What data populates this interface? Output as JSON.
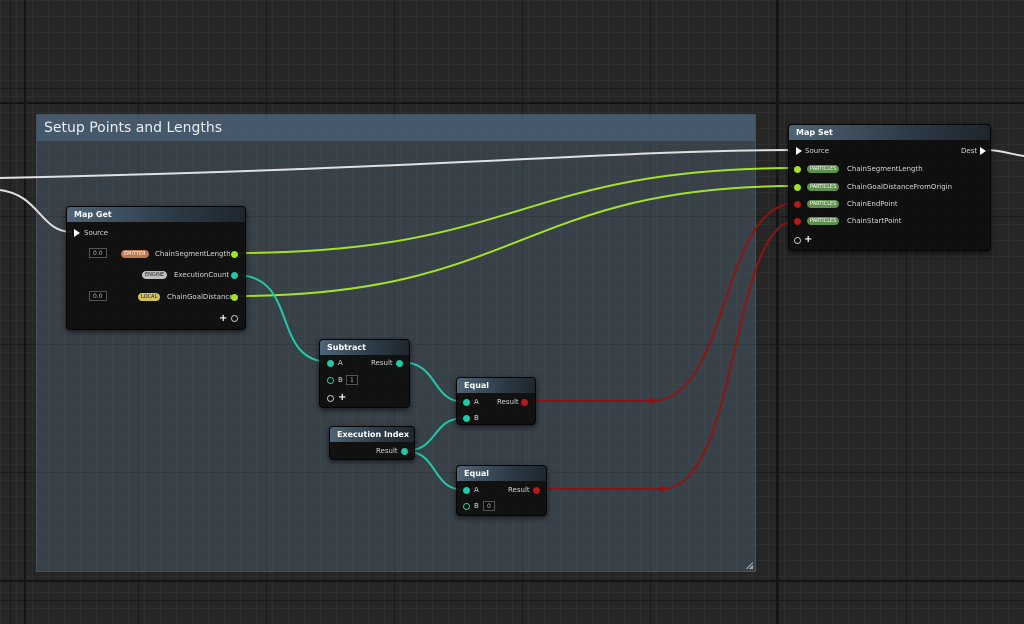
{
  "comment": {
    "title": "Setup Points and Lengths"
  },
  "map_get": {
    "title": "Map Get",
    "source_label": "Source",
    "rows": [
      {
        "badge": "EMITTER",
        "label": "ChainSegmentLength",
        "value": "0.0"
      },
      {
        "badge": "ENGINE",
        "label": "ExecutionCount"
      },
      {
        "badge": "LOCAL",
        "label": "ChainGoalDistance",
        "value": "0.0"
      }
    ],
    "add_symbol": "+"
  },
  "map_set": {
    "title": "Map Set",
    "source_label": "Source",
    "dest_label": "Dest",
    "rows": [
      {
        "badge": "PARTICLES",
        "label": "ChainSegmentLength"
      },
      {
        "badge": "PARTICLES",
        "label": "ChainGoalDistanceFromOrigin"
      },
      {
        "badge": "PARTICLES",
        "label": "ChainEndPoint"
      },
      {
        "badge": "PARTICLES",
        "label": "ChainStartPoint"
      }
    ],
    "add_symbol": "+"
  },
  "subtract": {
    "title": "Subtract",
    "a_label": "A",
    "b_label": "B",
    "b_value": "1",
    "result_label": "Result",
    "add_symbol": "+"
  },
  "execution_index": {
    "title": "Execution Index",
    "result_label": "Result"
  },
  "equal1": {
    "title": "Equal",
    "a_label": "A",
    "b_label": "B",
    "result_label": "Result"
  },
  "equal2": {
    "title": "Equal",
    "a_label": "A",
    "b_label": "B",
    "b_value": "0",
    "result_label": "Result"
  },
  "colors": {
    "float_pin": "#a4e22a",
    "int_pin": "#22c9a6",
    "bool_pin": "#b81818",
    "exec_wire": "#e0e0e0"
  }
}
